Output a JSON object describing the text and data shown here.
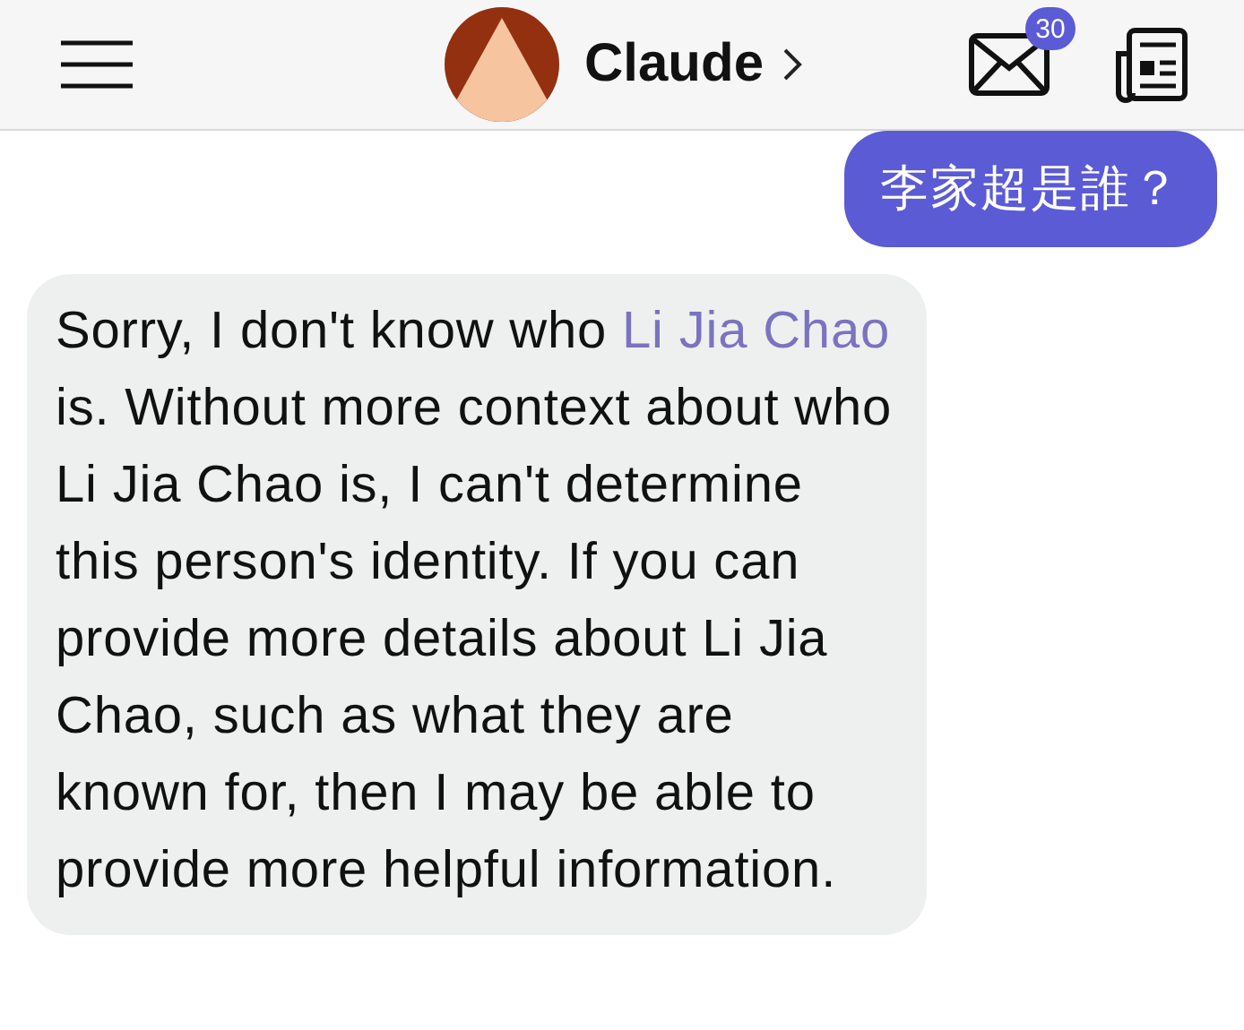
{
  "header": {
    "title": "Claude",
    "mail_badge": "30"
  },
  "messages": [
    {
      "kind": "user",
      "parts": [
        {
          "kind": "text",
          "text": "李家超是誰？"
        }
      ]
    },
    {
      "kind": "assistant",
      "parts": [
        {
          "kind": "text",
          "text": "Sorry, I don't know who "
        },
        {
          "kind": "link",
          "text": "Li Jia Chao"
        },
        {
          "kind": "text",
          "text": " is. Without more context about who Li Jia Chao is, I can't determine this person's identity. If you can provide more details about Li Jia Chao, such as what they are known for, then I may be able to provide more helpful information."
        }
      ]
    }
  ]
}
